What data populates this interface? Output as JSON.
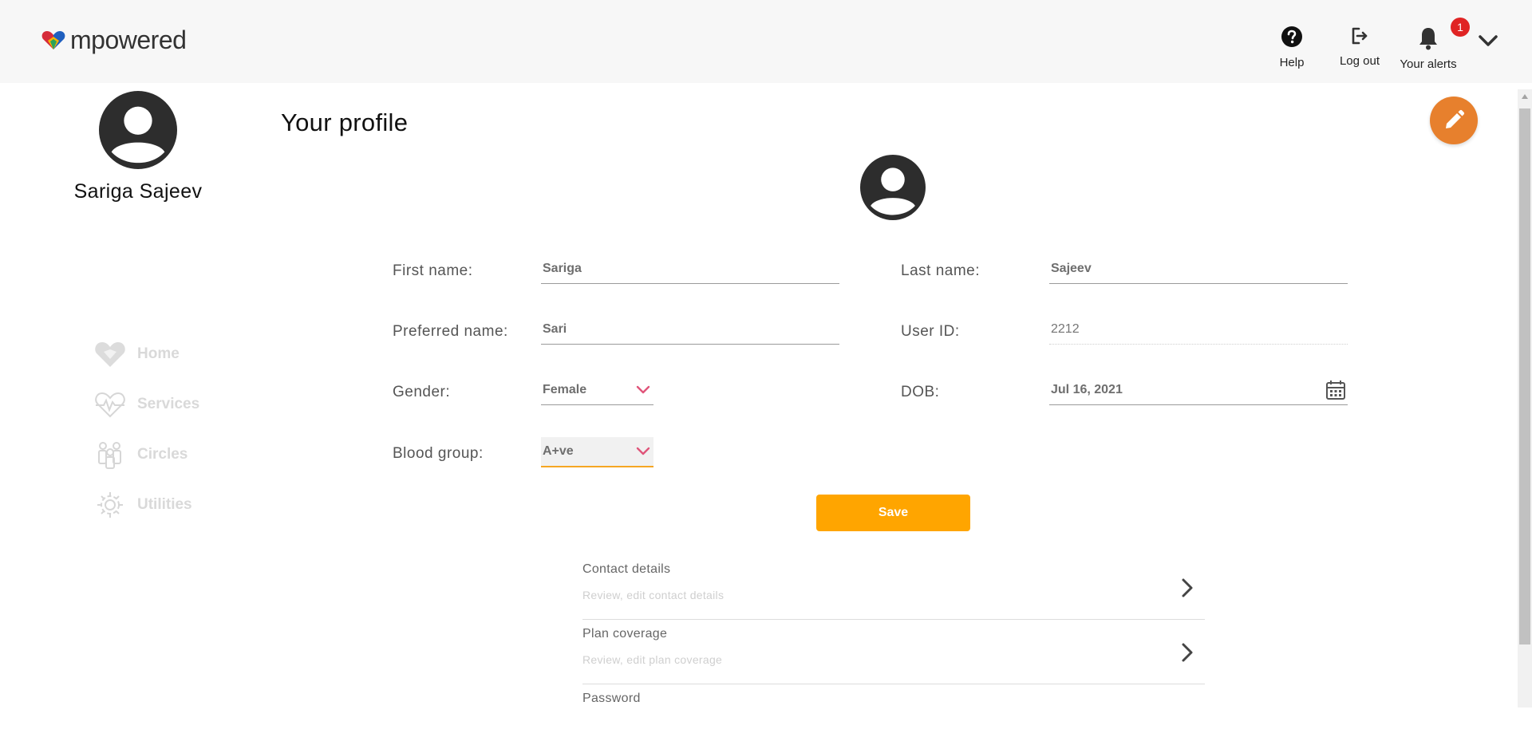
{
  "app": {
    "brand": "mpowered"
  },
  "header": {
    "help_label": "Help",
    "logout_label": "Log out",
    "alerts_label": "Your alerts",
    "alerts_count": "1"
  },
  "sidebar": {
    "user_name": "Sariga Sajeev",
    "items": [
      {
        "label": "Home",
        "icon": "heart-home-icon"
      },
      {
        "label": "Services",
        "icon": "heart-pulse-icon"
      },
      {
        "label": "Circles",
        "icon": "people-icon"
      },
      {
        "label": "Utilities",
        "icon": "gear-icon"
      }
    ]
  },
  "main": {
    "title": "Your profile",
    "fields": {
      "first_name": {
        "label": "First name:",
        "value": "Sariga"
      },
      "last_name": {
        "label": "Last name:",
        "value": "Sajeev"
      },
      "preferred_name": {
        "label": "Preferred name:",
        "value": "Sari"
      },
      "user_id": {
        "label": "User ID:",
        "placeholder": "2212"
      },
      "gender": {
        "label": "Gender:",
        "value": "Female"
      },
      "dob": {
        "label": "DOB:",
        "value": "Jul 16, 2021"
      },
      "blood_group": {
        "label": "Blood group:",
        "value": "A+ve"
      }
    },
    "save_label": "Save",
    "sections": [
      {
        "title": "Contact details",
        "subtitle": "Review, edit contact details"
      },
      {
        "title": "Plan coverage",
        "subtitle": "Review, edit plan coverage"
      },
      {
        "title": "Password",
        "subtitle": ""
      }
    ]
  },
  "colors": {
    "accent_orange": "#ffa500",
    "fab_orange": "#e7802d",
    "badge_red": "#e02424",
    "chevron_pink": "#e0557a",
    "focus_underline": "#f5a623"
  }
}
